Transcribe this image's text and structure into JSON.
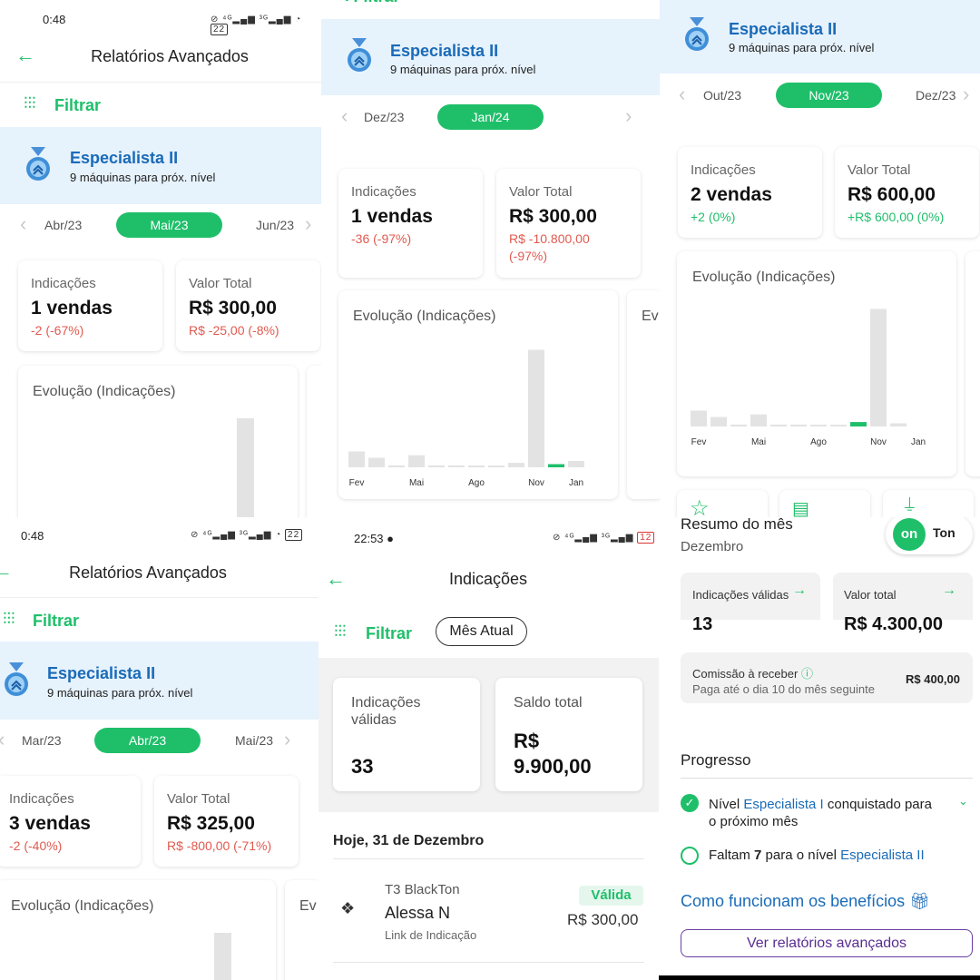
{
  "common": {
    "report_title": "Relatórios Avançados",
    "filter_label": "Filtrar",
    "level_title": "Especialista II",
    "level_sub": "9 máquinas para próx. nível",
    "label_indicacoes": "Indicações",
    "label_valor_total": "Valor Total",
    "chart_title": "Evolução (Indicações)",
    "chart_title_cut": "Ev"
  },
  "colors": {
    "accent": "#1fbf6a",
    "negative": "#e05a4f",
    "banner": "#e6f2fc",
    "level": "#1a6bb8",
    "bar_gray": "#e3e3e3"
  },
  "panel1": {
    "time": "0:48",
    "battery": "22",
    "months": {
      "prev": "Abr/23",
      "current": "Mai/23",
      "next": "Jun/23"
    },
    "indicacoes": "1 vendas",
    "indicacoes_delta": "-2 (-67%)",
    "valor": "R$ 300,00",
    "valor_delta": "R$ -25,00 (-8%)"
  },
  "panel2": {
    "months": {
      "prev": "Dez/23",
      "current": "Jan/24"
    },
    "indicacoes": "1 vendas",
    "indicacoes_delta": "-36 (-97%)",
    "valor": "R$ 300,00",
    "valor_delta_1": "R$ -10.800,00",
    "valor_delta_2": "(-97%)",
    "chart_data": {
      "type": "bar",
      "x_tick_labels": [
        "Fev",
        "Mai",
        "Ago",
        "Nov",
        "Jan"
      ],
      "values": [
        2.5,
        1.5,
        0.3,
        1.9,
        0.3,
        0.3,
        0,
        0,
        0.7,
        18.5,
        0.5,
        1
      ],
      "highlight_index": 10
    }
  },
  "panel3": {
    "months": {
      "prev": "Out/23",
      "current": "Nov/23",
      "next": "Dez/23"
    },
    "indicacoes": "2 vendas",
    "indicacoes_delta": "+2 (0%)",
    "valor": "R$ 600,00",
    "valor_delta": "+R$ 600,00 (0%)",
    "chart_data": {
      "type": "bar",
      "x_tick_labels": [
        "Fev",
        "Mai",
        "Ago",
        "Nov",
        "Jan"
      ],
      "values": [
        2.5,
        1.5,
        0.3,
        1.9,
        0.3,
        0.3,
        0,
        0,
        0.7,
        18.5,
        0.5
      ],
      "highlight_index": 8
    }
  },
  "panel4": {
    "time": "0:48",
    "battery": "22",
    "months": {
      "prev": "Mar/23",
      "current": "Abr/23",
      "next": "Mai/23"
    },
    "indicacoes": "3 vendas",
    "indicacoes_delta": "-2 (-40%)",
    "valor": "R$ 325,00",
    "valor_delta": "R$ -800,00 (-71%)"
  },
  "panel5": {
    "time": "22:53",
    "battery": "12",
    "title": "Indicações",
    "period_chip": "Mês Atual",
    "card1_label_1": "Indicações",
    "card1_label_2": "válidas",
    "card1_value": "33",
    "card2_label": "Saldo total",
    "card2_value_1": "R$",
    "card2_value_2": "9.900,00",
    "date_header": "Hoje, 31 de Dezembro",
    "item": {
      "product": "T3 BlackTon",
      "name": "Alessa N",
      "source": "Link de Indicação",
      "status": "Válida",
      "value": "R$ 300,00"
    }
  },
  "panel6": {
    "summary_title": "Resumo do mês",
    "summary_month": "Dezembro",
    "brand": "Ton",
    "brand_logo": "on",
    "card1_label": "Indicações válidas",
    "card1_value": "13",
    "card2_label": "Valor total",
    "card2_value": "R$ 4.300,00",
    "commission_label": "Comissão à receber",
    "commission_sub": "Paga até o dia 10 do mês seguinte",
    "commission_value": "R$ 400,00",
    "progress_title": "Progresso",
    "prog1_a": "Nível ",
    "prog1_level": "Especialista I",
    "prog1_b": " conquistado para",
    "prog1_c": "o próximo mês",
    "prog2_a": "Faltam ",
    "prog2_n": "7",
    "prog2_b": " para o nível ",
    "prog2_level": "Especialista II",
    "benefits_link": "Como funcionam os benefícios",
    "reports_button": "Ver relatórios avançados"
  }
}
